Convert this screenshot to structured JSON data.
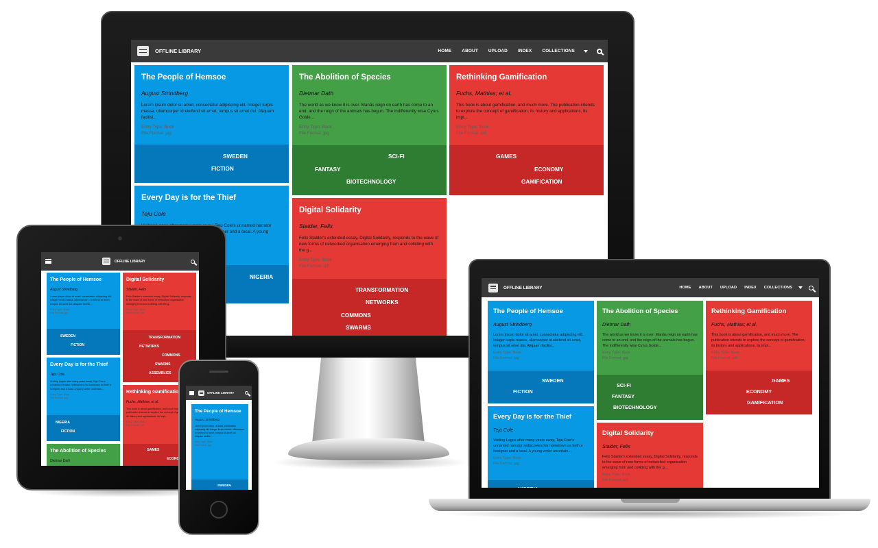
{
  "app": {
    "brand": "OFFLINE LIBRARY",
    "nav": [
      {
        "label": "HOME"
      },
      {
        "label": "ABOUT"
      },
      {
        "label": "UPLOAD"
      },
      {
        "label": "INDEX"
      },
      {
        "label": "COLLECTIONS"
      }
    ],
    "icons": {
      "logo": "stacked-books-icon",
      "dropdown": "caret-down-icon",
      "search": "search-icon",
      "menu": "hamburger-menu-icon"
    }
  },
  "colors": {
    "topbar": "#3a3a3a",
    "blue": "#0799e4",
    "blue_dark": "#0578bb",
    "green": "#44a047",
    "green_dark": "#2f7d32",
    "red": "#e53935",
    "red_dark": "#c62828"
  },
  "books": {
    "hemsoe": {
      "title": "The People of Hemsoe",
      "author": "August Strindberg",
      "desc_monitor": "Lorem ipsum dolor sit amet, consectetur adipiscing elit. Integer turpis massa, ullamcorper id eleifend sit amet, tempus sit amet dui. Aliquam facilisi...",
      "desc_laptop": "Lorem ipsum dolor sit amet, consectetur adipiscing elit. Integer turpis massa, ullamcorper id eleifend sit amet, tempus sit amet dui. Aliquam facilisi...",
      "entry_type": "Entry Type: Book",
      "file_format": "File Format: jpg",
      "tags": [
        "SWEDEN",
        "FICTION"
      ]
    },
    "species": {
      "title": "The Abolition of Species",
      "author": "Dietmar Dath",
      "desc_monitor": "The world as we know it is over. Manās reign on earth has come to an end, and the reign of the animals has begun. The indifferently wise Cyrus Golde...",
      "desc_laptop": "The world as we know it is over. Manās reign on earth has come to an end, and the reign of the animals has begun. The indifferently wise Cyrus Golde...",
      "entry_type": "Entry Type: Book",
      "file_format": "File Format: jpg",
      "tags": [
        "SCI-FI",
        "FANTASY",
        "BIOTECHNOLOGY"
      ]
    },
    "gamification": {
      "title": "Rethinking Gamification",
      "author": "Fuchs, Mathias; et al.",
      "desc_monitor": "This book is about gamification, and much more. The publication intends to explore the concept of gamification, its history and applications, its impl...",
      "desc_laptop": "This book is about gamification, and much more. The publication intends to explore the concept of gamification, its history and applications, its impl...",
      "entry_type": "Entry Type: Book",
      "file_format": "File Format: pdf",
      "tags": [
        "GAMES",
        "ECONOMY",
        "GAMIFICATION"
      ]
    },
    "thief": {
      "title": "Every Day is for the Thief",
      "author": "Teju Cole",
      "desc_monitor": "Visiting Lagos after many years away, Teju Cole's unnamed narrator rediscovers his hometown as both a foreigner and a local. A young",
      "desc_laptop": "Visiting Lagos after many years away, Teju Cole's unnamed narrator rediscovers his hometown as both a foreigner and a local. A young writer uncertain...",
      "entry_type": "Entry Type: Book",
      "file_format": "File Format: jpg",
      "tags": [
        "NIGERIA",
        "FICTION"
      ]
    },
    "solidarity": {
      "title": "Digital Solidarity",
      "author": "Staider, Felix",
      "desc_monitor": "Felix Stalder's extended essay, Digital Solidarity, responds to the wave of new forms of networked organisation emerging from and colliding with the g...",
      "desc_laptop": "Felix Stalder's extended essay, Digital Solidarity, responds to the wave of new forms of networked organisation emerging from and colliding with the g...",
      "entry_type": "Entry Type: Book",
      "file_format": "File Format: pdf",
      "tags": [
        "TRANSFORMATION",
        "NETWORKS",
        "COMMONS",
        "SWARMS",
        "ASSEMBLIES"
      ]
    }
  }
}
